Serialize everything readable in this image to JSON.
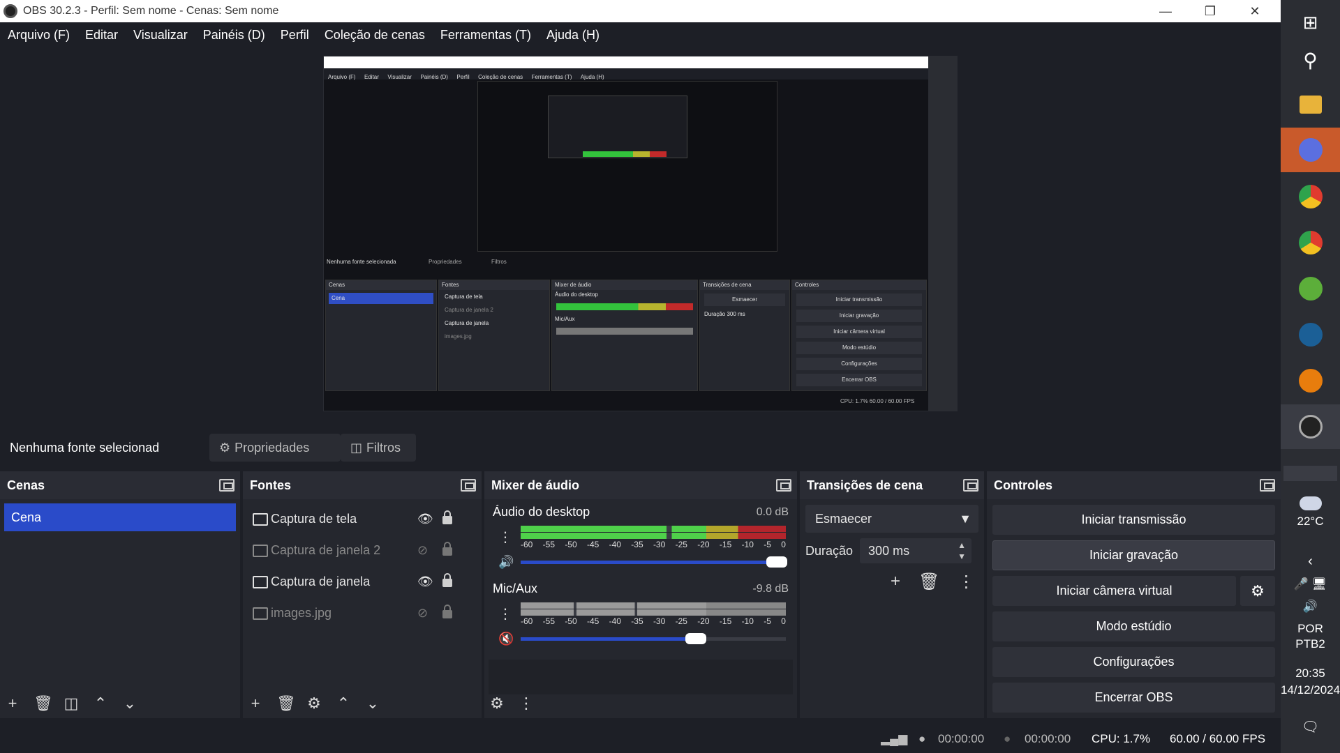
{
  "window": {
    "title": "OBS 30.2.3 - Perfil: Sem nome - Cenas: Sem nome"
  },
  "menu": [
    "Arquivo (F)",
    "Editar",
    "Visualizar",
    "Painéis (D)",
    "Perfil",
    "Coleção de cenas",
    "Ferramentas (T)",
    "Ajuda (H)"
  ],
  "info": {
    "no_source": "Nenhuma fonte selecionad",
    "properties": "Propriedades",
    "filters": "Filtros"
  },
  "scenes": {
    "title": "Cenas",
    "items": [
      "Cena"
    ]
  },
  "sources": {
    "title": "Fontes",
    "items": [
      {
        "name": "Captura de tela",
        "visible": true
      },
      {
        "name": "Captura de janela 2",
        "visible": false
      },
      {
        "name": "Captura de janela",
        "visible": true
      },
      {
        "name": "images.jpg",
        "visible": false
      }
    ]
  },
  "mixer": {
    "title": "Mixer de áudio",
    "ticks": [
      "-60",
      "-55",
      "-50",
      "-45",
      "-40",
      "-35",
      "-30",
      "-25",
      "-20",
      "-15",
      "-10",
      "-5",
      "0"
    ],
    "channels": [
      {
        "name": "Áudio do desktop",
        "db": "0.0 dB",
        "volume": 1.0,
        "muted": false
      },
      {
        "name": "Mic/Aux",
        "db": "-9.8 dB",
        "volume": 0.66,
        "muted": true
      }
    ]
  },
  "transitions": {
    "title": "Transições de cena",
    "selected": "Esmaecer",
    "duration_label": "Duração",
    "duration": "300 ms"
  },
  "controls": {
    "title": "Controles",
    "start_stream": "Iniciar transmissão",
    "start_record": "Iniciar gravação",
    "start_virtualcam": "Iniciar câmera virtual",
    "studio_mode": "Modo estúdio",
    "settings": "Configurações",
    "exit": "Encerrar OBS"
  },
  "status": {
    "stream_time": "00:00:00",
    "record_time": "00:00:00",
    "cpu": "CPU: 1.7%",
    "fps": "60.00 / 60.00 FPS"
  },
  "taskbar": {
    "weather": "22°C",
    "lang1": "POR",
    "lang2": "PTB2",
    "time": "20:35",
    "date": "14/12/2024"
  },
  "preview_mini": {
    "menu": [
      "Arquivo (F)",
      "Editar",
      "Visualizar",
      "Painéis (D)",
      "Perfil",
      "Coleção de cenas",
      "Ferramentas (T)",
      "Ajuda (H)"
    ],
    "no_source": "Nenhuma fonte selecionada",
    "properties": "Propriedades",
    "filters": "Filtros",
    "scenes": "Cenas",
    "scene": "Cena",
    "sources": "Fontes",
    "src1": "Captura de tela",
    "src2": "Captura de janela 2",
    "src3": "Captura de janela",
    "src4": "images.jpg",
    "mixer": "Mixer de áudio",
    "desktop": "Áudio do desktop",
    "mic": "Mic/Aux",
    "transitions": "Transições de cena",
    "fade": "Esmaecer",
    "duration": "Duração",
    "duration_val": "300 ms",
    "controls": "Controles",
    "b1": "Iniciar transmissão",
    "b2": "Iniciar gravação",
    "b3": "Iniciar câmera virtual",
    "b4": "Modo estúdio",
    "b5": "Configurações",
    "b6": "Encerrar OBS",
    "status": "CPU: 1.7%  60.00 / 60.00 FPS"
  },
  "colors": {
    "accent": "#2a4bc9",
    "panel": "#25272e",
    "bg": "#1d1f26"
  }
}
